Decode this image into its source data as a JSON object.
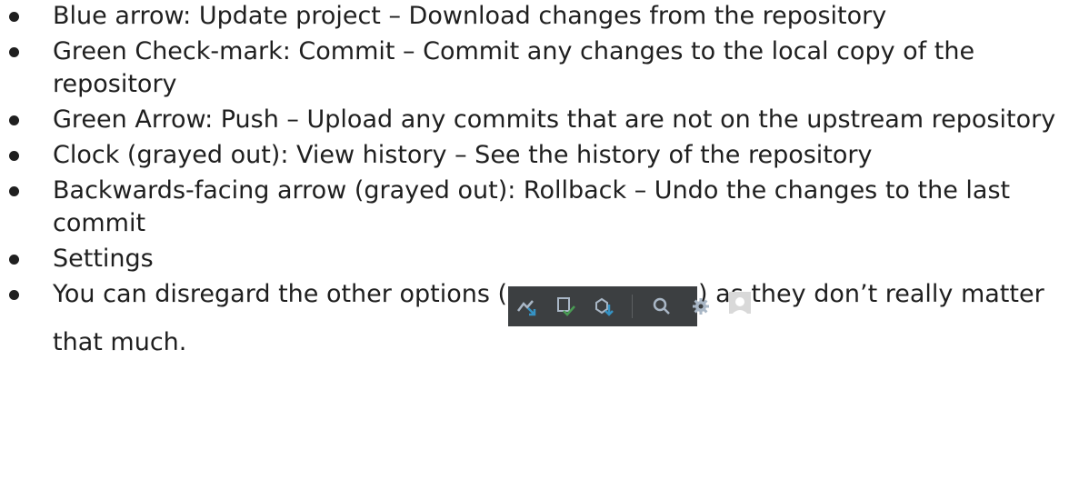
{
  "items": [
    {
      "text": "Blue arrow: Update project – Download changes from the repository"
    },
    {
      "text": "Green Check-mark: Commit – Commit any changes to the local copy of the repository"
    },
    {
      "text": "Green Arrow: Push – Upload any commits that are not on the upstream repository"
    },
    {
      "text": "Clock (grayed out): View history – See the history of the repository"
    },
    {
      "text": "Backwards-facing arrow (grayed out): Rollback – Undo the changes to the last commit"
    },
    {
      "text": "Settings"
    }
  ],
  "last_item": {
    "before": "You can disregard the other options (",
    "after": ") as they don’t really matter that much."
  },
  "toolbar_icons": [
    "vcs-update-arrow-icon",
    "commit-check-icon",
    "push-arrow-icon",
    "search-icon",
    "gear-icon",
    "user-avatar-icon"
  ],
  "colors": {
    "text": "#1f1f1f",
    "toolbar_bg": "#3c3f41",
    "icon_gray": "#a9b7c6",
    "icon_blue": "#3592c4",
    "icon_green": "#499c54"
  }
}
